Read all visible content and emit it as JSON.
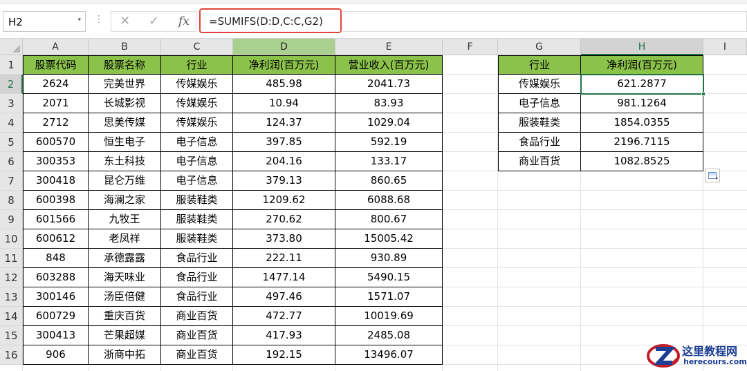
{
  "formula_bar": {
    "name_box": "H2",
    "dropdown_glyph": "▾",
    "cancel_glyph": "✕",
    "enter_glyph": "✓",
    "fx_label": "fx",
    "formula": "=SUMIFS(D:D,C:C,G2)"
  },
  "selected_cell": {
    "column": "H",
    "row": "2"
  },
  "columns": [
    "A",
    "B",
    "C",
    "D",
    "E",
    "F",
    "G",
    "H",
    "I"
  ],
  "rows": [
    "1",
    "2",
    "3",
    "4",
    "5",
    "6",
    "7",
    "8",
    "9",
    "10",
    "11",
    "12",
    "13",
    "14",
    "15",
    "16"
  ],
  "left_table": {
    "headers": [
      "股票代码",
      "股票名称",
      "行业",
      "净利润(百万元)",
      "营业收入(百万元)"
    ],
    "rows": [
      [
        "2624",
        "完美世界",
        "传媒娱乐",
        "485.98",
        "2041.73"
      ],
      [
        "2071",
        "长城影视",
        "传媒娱乐",
        "10.94",
        "83.93"
      ],
      [
        "2712",
        "思美传媒",
        "传媒娱乐",
        "124.37",
        "1029.04"
      ],
      [
        "600570",
        "恒生电子",
        "电子信息",
        "397.85",
        "592.19"
      ],
      [
        "300353",
        "东土科技",
        "电子信息",
        "204.16",
        "133.17"
      ],
      [
        "300418",
        "昆仑万维",
        "电子信息",
        "379.13",
        "860.65"
      ],
      [
        "600398",
        "海澜之家",
        "服装鞋类",
        "1209.62",
        "6088.68"
      ],
      [
        "601566",
        "九牧王",
        "服装鞋类",
        "270.62",
        "800.67"
      ],
      [
        "600612",
        "老凤祥",
        "服装鞋类",
        "373.80",
        "15005.42"
      ],
      [
        "848",
        "承德露露",
        "食品行业",
        "222.11",
        "930.89"
      ],
      [
        "603288",
        "海天味业",
        "食品行业",
        "1477.14",
        "5490.15"
      ],
      [
        "300146",
        "汤臣倍健",
        "食品行业",
        "497.46",
        "1571.07"
      ],
      [
        "600729",
        "重庆百货",
        "商业百货",
        "472.77",
        "10019.69"
      ],
      [
        "300413",
        "芒果超媒",
        "商业百货",
        "417.93",
        "2485.08"
      ],
      [
        "906",
        "浙商中拓",
        "商业百货",
        "192.15",
        "13496.07"
      ]
    ]
  },
  "summary_table": {
    "headers": [
      "行业",
      "净利润(百万元)"
    ],
    "rows": [
      [
        "传媒娱乐",
        "621.2877"
      ],
      [
        "电子信息",
        "981.1264"
      ],
      [
        "服装鞋类",
        "1854.0355"
      ],
      [
        "食品行业",
        "2196.7115"
      ],
      [
        "商业百货",
        "1082.8525"
      ]
    ]
  },
  "colors": {
    "header_fill": "#8bc34a",
    "selection_green": "#217346",
    "formula_highlight": "#e0453a",
    "grid_line": "#e1e1e1"
  },
  "icons": {
    "paste_options": "paste-options-icon",
    "watermark_logo": "z-seal-logo"
  },
  "watermark": {
    "title": "这里教程网",
    "url": "herecours.com"
  }
}
